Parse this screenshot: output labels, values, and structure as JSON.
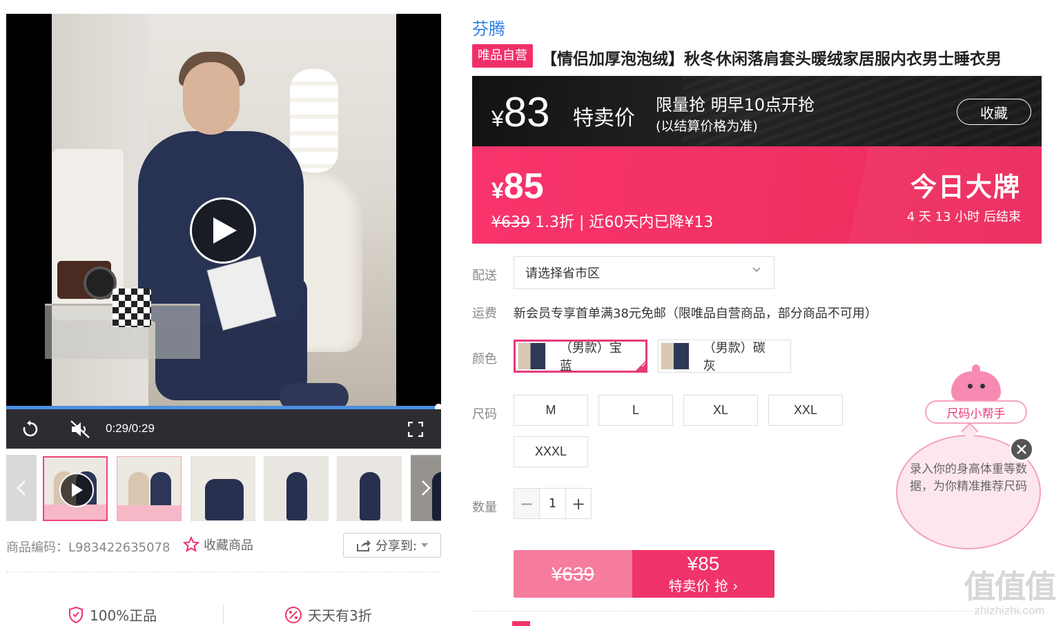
{
  "media": {
    "timecode": "0:29/0:29",
    "progress": 1.0,
    "muted": true
  },
  "product": {
    "sku_label": "商品编码：L983422635078",
    "favorite_label": "收藏商品",
    "share_label": "分享到:",
    "promise_1": "100%正品",
    "promise_2": "天天有3折"
  },
  "info": {
    "brand": "芬腾",
    "self_badge": "唯品自营",
    "title": "【情侣加厚泡泡绒】秋冬休闲落肩套头暖绒家居服内衣男士睡衣男"
  },
  "special": {
    "yen": "¥",
    "price": "83",
    "label": "特卖价",
    "limit_line1": "限量抢 明早10点开抢",
    "limit_line2": "(以结算价格为准)",
    "collect": "收藏"
  },
  "promo": {
    "yen": "¥",
    "price": "85",
    "orig_price": "¥639",
    "detail": " 1.3折 | 近60天内已降¥13",
    "event": "今日大牌",
    "countdown": "4 天 13 小时 后结束"
  },
  "delivery": {
    "label": "配送",
    "placeholder": "请选择省市区"
  },
  "freight": {
    "label": "运费",
    "text": "新会员专享首单满38元免邮（限唯品自营商品，部分商品不可用）"
  },
  "colors": {
    "label": "颜色",
    "options": [
      {
        "name": "（男款）宝蓝",
        "selected": true
      },
      {
        "name": "（男款）碳灰",
        "selected": false
      }
    ]
  },
  "sizes": {
    "label": "尺码",
    "options": [
      "M",
      "L",
      "XL",
      "XXL",
      "XXXL"
    ]
  },
  "quantity": {
    "label": "数量",
    "value": "1",
    "minus": "−",
    "plus": "+"
  },
  "buy": {
    "orig": "¥639",
    "price": "¥85",
    "action": "特卖价 抢 ›"
  },
  "helper": {
    "pill": "尺码小帮手",
    "text": "录入你的身高体重等数据，为你精准推荐尺码"
  },
  "watermark": {
    "big": "值值值",
    "small": "zhizhizhi.com"
  },
  "colors_theme": {
    "accent": "#f0336a",
    "brand_blue": "#2b7de9",
    "progress_blue": "#4a90e2"
  }
}
